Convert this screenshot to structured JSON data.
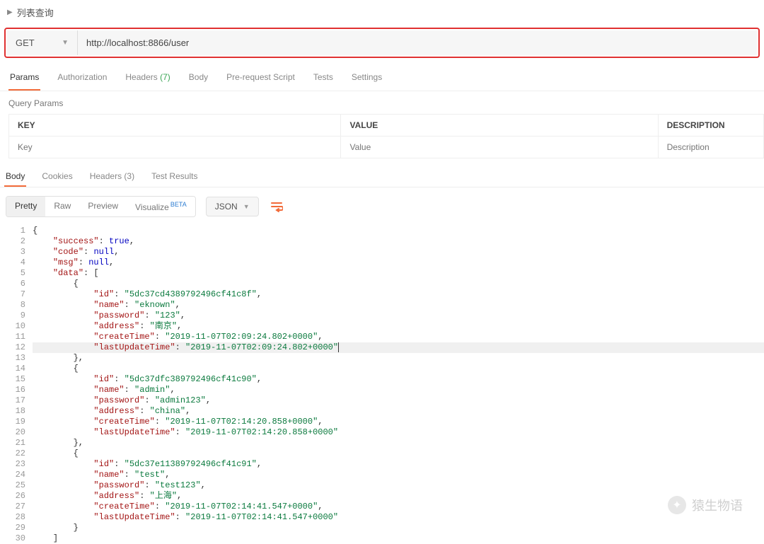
{
  "header": {
    "title": "列表查询"
  },
  "request": {
    "method": "GET",
    "url": "http://localhost:8866/user"
  },
  "tabs": {
    "params": "Params",
    "authorization": "Authorization",
    "headers_label": "Headers",
    "headers_count": "(7)",
    "body": "Body",
    "pre_request": "Pre-request Script",
    "tests": "Tests",
    "settings": "Settings"
  },
  "query_params": {
    "title": "Query Params",
    "columns": {
      "key": "KEY",
      "value": "VALUE",
      "description": "DESCRIPTION"
    },
    "placeholders": {
      "key": "Key",
      "value": "Value",
      "description": "Description"
    }
  },
  "response_tabs": {
    "body": "Body",
    "cookies": "Cookies",
    "headers_label": "Headers",
    "headers_count": "(3)",
    "test_results": "Test Results"
  },
  "toolbar": {
    "pretty": "Pretty",
    "raw": "Raw",
    "preview": "Preview",
    "visualize": "Visualize",
    "visualize_badge": "BETA",
    "format": "JSON"
  },
  "json_lines": [
    [
      [
        "punc",
        "{"
      ]
    ],
    [
      [
        "pad",
        "    "
      ],
      [
        "key",
        "\"success\""
      ],
      [
        "punc",
        ": "
      ],
      [
        "kw",
        "true"
      ],
      [
        "punc",
        ","
      ]
    ],
    [
      [
        "pad",
        "    "
      ],
      [
        "key",
        "\"code\""
      ],
      [
        "punc",
        ": "
      ],
      [
        "kw",
        "null"
      ],
      [
        "punc",
        ","
      ]
    ],
    [
      [
        "pad",
        "    "
      ],
      [
        "key",
        "\"msg\""
      ],
      [
        "punc",
        ": "
      ],
      [
        "kw",
        "null"
      ],
      [
        "punc",
        ","
      ]
    ],
    [
      [
        "pad",
        "    "
      ],
      [
        "key",
        "\"data\""
      ],
      [
        "punc",
        ": ["
      ]
    ],
    [
      [
        "pad",
        "        "
      ],
      [
        "punc",
        "{"
      ]
    ],
    [
      [
        "pad",
        "            "
      ],
      [
        "key",
        "\"id\""
      ],
      [
        "punc",
        ": "
      ],
      [
        "str",
        "\"5dc37cd4389792496cf41c8f\""
      ],
      [
        "punc",
        ","
      ]
    ],
    [
      [
        "pad",
        "            "
      ],
      [
        "key",
        "\"name\""
      ],
      [
        "punc",
        ": "
      ],
      [
        "str",
        "\"eknown\""
      ],
      [
        "punc",
        ","
      ]
    ],
    [
      [
        "pad",
        "            "
      ],
      [
        "key",
        "\"password\""
      ],
      [
        "punc",
        ": "
      ],
      [
        "str",
        "\"123\""
      ],
      [
        "punc",
        ","
      ]
    ],
    [
      [
        "pad",
        "            "
      ],
      [
        "key",
        "\"address\""
      ],
      [
        "punc",
        ": "
      ],
      [
        "str",
        "\"南京\""
      ],
      [
        "punc",
        ","
      ]
    ],
    [
      [
        "pad",
        "            "
      ],
      [
        "key",
        "\"createTime\""
      ],
      [
        "punc",
        ": "
      ],
      [
        "str",
        "\"2019-11-07T02:09:24.802+0000\""
      ],
      [
        "punc",
        ","
      ]
    ],
    [
      [
        "pad",
        "            "
      ],
      [
        "key",
        "\"lastUpdateTime\""
      ],
      [
        "punc",
        ": "
      ],
      [
        "str",
        "\"2019-11-07T02:09:24.802+0000\""
      ],
      [
        "cursor",
        ""
      ]
    ],
    [
      [
        "pad",
        "        "
      ],
      [
        "punc",
        "},"
      ]
    ],
    [
      [
        "pad",
        "        "
      ],
      [
        "punc",
        "{"
      ]
    ],
    [
      [
        "pad",
        "            "
      ],
      [
        "key",
        "\"id\""
      ],
      [
        "punc",
        ": "
      ],
      [
        "str",
        "\"5dc37dfc389792496cf41c90\""
      ],
      [
        "punc",
        ","
      ]
    ],
    [
      [
        "pad",
        "            "
      ],
      [
        "key",
        "\"name\""
      ],
      [
        "punc",
        ": "
      ],
      [
        "str",
        "\"admin\""
      ],
      [
        "punc",
        ","
      ]
    ],
    [
      [
        "pad",
        "            "
      ],
      [
        "key",
        "\"password\""
      ],
      [
        "punc",
        ": "
      ],
      [
        "str",
        "\"admin123\""
      ],
      [
        "punc",
        ","
      ]
    ],
    [
      [
        "pad",
        "            "
      ],
      [
        "key",
        "\"address\""
      ],
      [
        "punc",
        ": "
      ],
      [
        "str",
        "\"china\""
      ],
      [
        "punc",
        ","
      ]
    ],
    [
      [
        "pad",
        "            "
      ],
      [
        "key",
        "\"createTime\""
      ],
      [
        "punc",
        ": "
      ],
      [
        "str",
        "\"2019-11-07T02:14:20.858+0000\""
      ],
      [
        "punc",
        ","
      ]
    ],
    [
      [
        "pad",
        "            "
      ],
      [
        "key",
        "\"lastUpdateTime\""
      ],
      [
        "punc",
        ": "
      ],
      [
        "str",
        "\"2019-11-07T02:14:20.858+0000\""
      ]
    ],
    [
      [
        "pad",
        "        "
      ],
      [
        "punc",
        "},"
      ]
    ],
    [
      [
        "pad",
        "        "
      ],
      [
        "punc",
        "{"
      ]
    ],
    [
      [
        "pad",
        "            "
      ],
      [
        "key",
        "\"id\""
      ],
      [
        "punc",
        ": "
      ],
      [
        "str",
        "\"5dc37e11389792496cf41c91\""
      ],
      [
        "punc",
        ","
      ]
    ],
    [
      [
        "pad",
        "            "
      ],
      [
        "key",
        "\"name\""
      ],
      [
        "punc",
        ": "
      ],
      [
        "str",
        "\"test\""
      ],
      [
        "punc",
        ","
      ]
    ],
    [
      [
        "pad",
        "            "
      ],
      [
        "key",
        "\"password\""
      ],
      [
        "punc",
        ": "
      ],
      [
        "str",
        "\"test123\""
      ],
      [
        "punc",
        ","
      ]
    ],
    [
      [
        "pad",
        "            "
      ],
      [
        "key",
        "\"address\""
      ],
      [
        "punc",
        ": "
      ],
      [
        "str",
        "\"上海\""
      ],
      [
        "punc",
        ","
      ]
    ],
    [
      [
        "pad",
        "            "
      ],
      [
        "key",
        "\"createTime\""
      ],
      [
        "punc",
        ": "
      ],
      [
        "str",
        "\"2019-11-07T02:14:41.547+0000\""
      ],
      [
        "punc",
        ","
      ]
    ],
    [
      [
        "pad",
        "            "
      ],
      [
        "key",
        "\"lastUpdateTime\""
      ],
      [
        "punc",
        ": "
      ],
      [
        "str",
        "\"2019-11-07T02:14:41.547+0000\""
      ]
    ],
    [
      [
        "pad",
        "        "
      ],
      [
        "punc",
        "}"
      ]
    ],
    [
      [
        "pad",
        "    "
      ],
      [
        "punc",
        "]"
      ]
    ]
  ],
  "highlight_line": 12,
  "watermark": {
    "text": "猿生物语"
  }
}
